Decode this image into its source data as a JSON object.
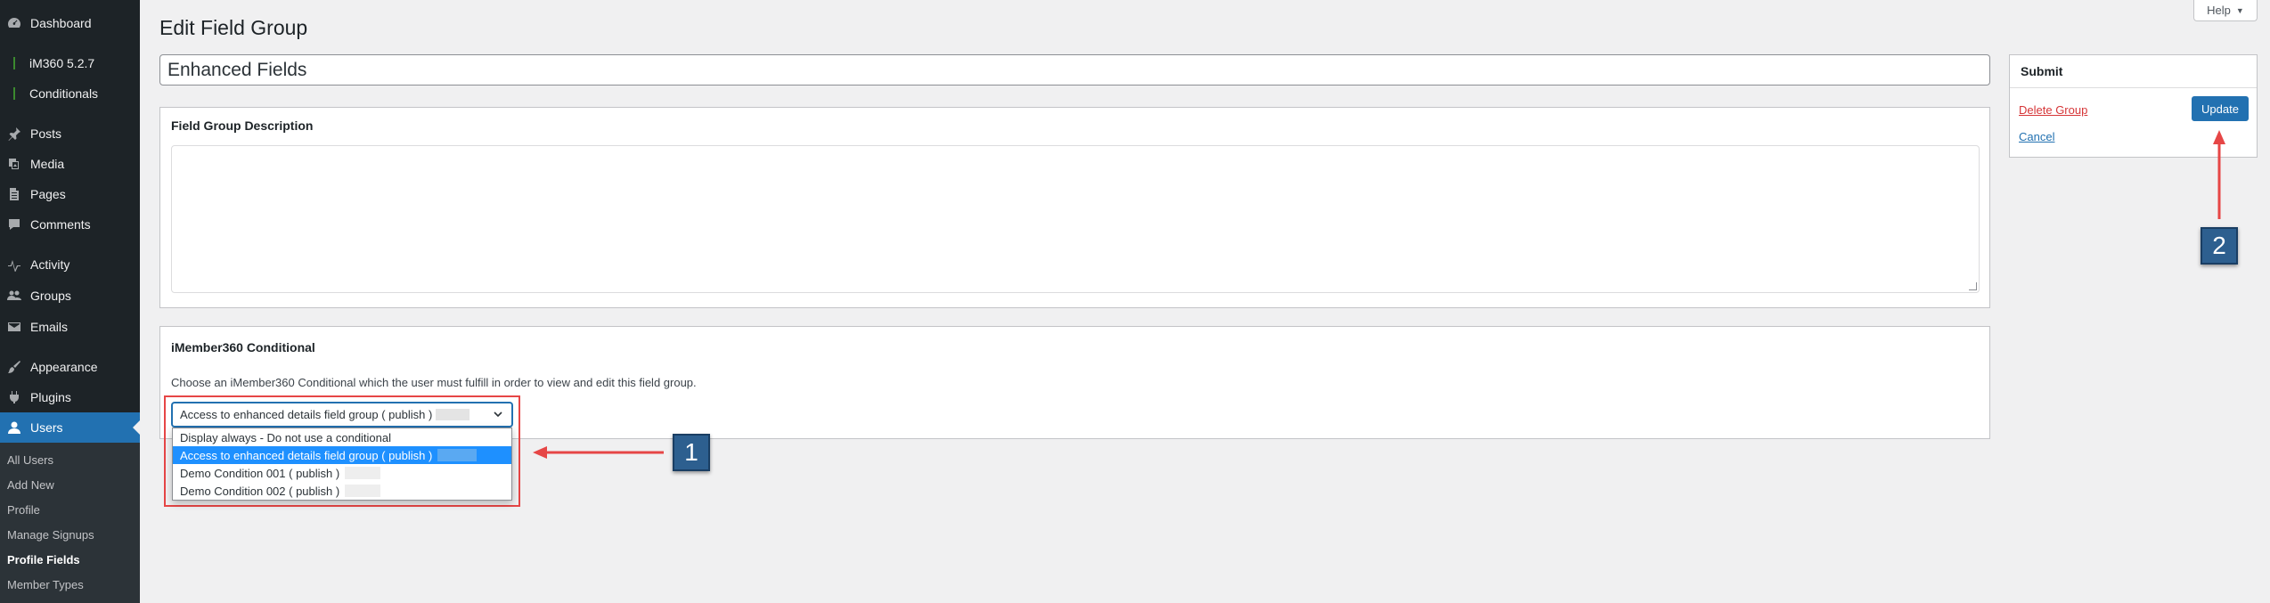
{
  "sidebar": {
    "items": [
      {
        "label": "Dashboard",
        "icon": "dashboard-icon"
      },
      {
        "label": "iM360 5.2.7",
        "icon": "plugin-bar-icon"
      },
      {
        "label": "Conditionals",
        "icon": "plugin-bar-icon"
      },
      {
        "label": "Posts",
        "icon": "pin-icon"
      },
      {
        "label": "Media",
        "icon": "media-icon"
      },
      {
        "label": "Pages",
        "icon": "pages-icon"
      },
      {
        "label": "Comments",
        "icon": "comments-icon"
      },
      {
        "label": "Activity",
        "icon": "activity-icon"
      },
      {
        "label": "Groups",
        "icon": "groups-icon"
      },
      {
        "label": "Emails",
        "icon": "email-icon"
      },
      {
        "label": "Appearance",
        "icon": "brush-icon"
      },
      {
        "label": "Plugins",
        "icon": "plugins-icon"
      },
      {
        "label": "Users",
        "icon": "users-icon"
      }
    ],
    "submenu": [
      "All Users",
      "Add New",
      "Profile",
      "Manage Signups",
      "Profile Fields",
      "Member Types"
    ]
  },
  "header": {
    "title": "Edit Field Group",
    "help": "Help"
  },
  "main": {
    "title_value": "Enhanced Fields",
    "description_box_title": "Field Group Description",
    "conditional_box": {
      "title": "iMember360 Conditional",
      "help": "Choose an iMember360 Conditional which the user must fulfill in order to view and edit this field group.",
      "selected": "Access to enhanced details field group ( publish )",
      "options": [
        "Display always - Do not use a conditional",
        "Access to enhanced details field group ( publish )",
        "Demo Condition 001 ( publish )",
        "Demo Condition 002 ( publish )"
      ]
    }
  },
  "submit_box": {
    "title": "Submit",
    "delete": "Delete Group",
    "cancel": "Cancel",
    "update": "Update"
  },
  "callouts": {
    "one": "1",
    "two": "2"
  },
  "colors": {
    "accent": "#2271b1",
    "sidebar": "#1d2327",
    "arrow": "#e64646",
    "callout": "#2d5f8f"
  }
}
